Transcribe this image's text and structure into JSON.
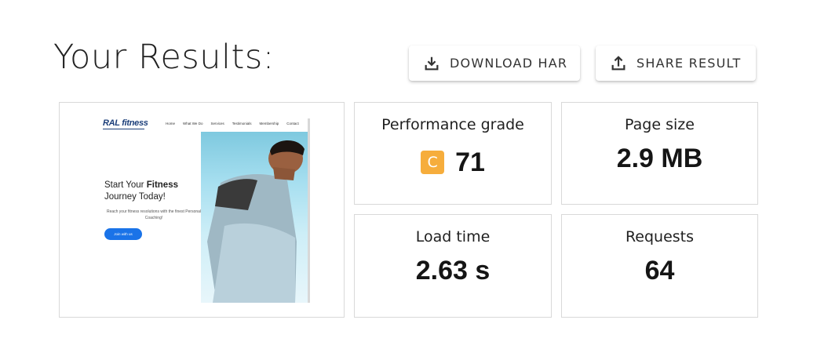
{
  "page": {
    "title": "Your Results:"
  },
  "actions": {
    "download_label": "DOWNLOAD HAR",
    "share_label": "SHARE RESULT"
  },
  "preview": {
    "logo": "RAL fitness",
    "nav": [
      "Home",
      "What We Do",
      "Services",
      "Testimonials",
      "Membership",
      "Contact"
    ],
    "headline_plain": "Start Your ",
    "headline_bold": "Fitness",
    "headline_line2": "Journey Today!",
    "subtext": "Reach your fitness resolutions with the finest Personal Coaching!",
    "cta": "Join with us"
  },
  "metrics": {
    "performance": {
      "label": "Performance grade",
      "grade": "C",
      "score": "71",
      "grade_color": "#f6ad3c"
    },
    "page_size": {
      "label": "Page size",
      "value": "2.9 MB"
    },
    "load_time": {
      "label": "Load time",
      "value": "2.63 s"
    },
    "requests": {
      "label": "Requests",
      "value": "64"
    }
  },
  "icons": {
    "download": "download-icon",
    "share": "share-icon"
  }
}
